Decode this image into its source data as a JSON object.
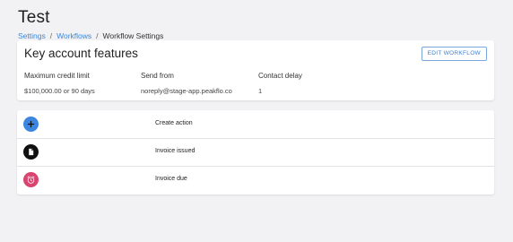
{
  "page": {
    "title": "Test"
  },
  "breadcrumb": {
    "items": [
      {
        "label": "Settings",
        "link": true
      },
      {
        "label": "Workflows",
        "link": true
      },
      {
        "label": "Workflow Settings",
        "link": false
      }
    ],
    "separator": "/"
  },
  "features": {
    "title": "Key account features",
    "edit_label": "EDIT WORKFLOW",
    "fields": [
      {
        "label": "Maximum credit limit",
        "value": "$100,000.00 or 90 days"
      },
      {
        "label": "Send from",
        "value": "noreply@stage-app.peakflo.co"
      },
      {
        "label": "Contact delay",
        "value": "1"
      }
    ]
  },
  "actions": {
    "rows": [
      {
        "label": "Create action",
        "icon": "plus-icon",
        "color": "#3d86e0"
      },
      {
        "label": "Invoice issued",
        "icon": "document-icon",
        "color": "#111111"
      },
      {
        "label": "Invoice due",
        "icon": "alarm-clock-icon",
        "color": "#d9456f"
      }
    ]
  }
}
